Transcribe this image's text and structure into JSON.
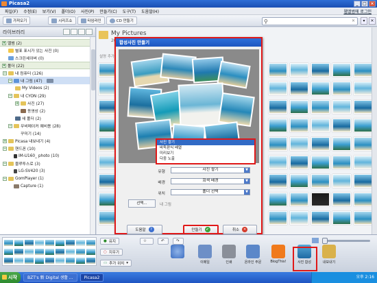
{
  "window": {
    "title": "Picasa2"
  },
  "menu": [
    "파일(F)",
    "수정(E)",
    "보기(V)",
    "폴더(O)",
    "사진(P)",
    "만들기(C)",
    "도구(T)",
    "도움말(H)"
  ],
  "signin": "웹앨범에 로그인",
  "toolbar": [
    "가져오기",
    "시리즈쇼",
    "타임라인",
    "CD 만들기"
  ],
  "library": {
    "title": "라이브러리",
    "tree": [
      {
        "label": "앨범 (2)",
        "group": true
      },
      {
        "label": "별표 표시가 있는 사진 (0)"
      },
      {
        "label": "스크린세이버 (0)"
      },
      {
        "label": "폴더 (22)",
        "group": true
      },
      {
        "label": "내 컴퓨터 (126)"
      },
      {
        "label": "내 그림 (47)"
      },
      {
        "label": "My Videos (2)"
      },
      {
        "label": "내 CYON (29)"
      },
      {
        "label": "사진 (27)"
      },
      {
        "label": "동영상 (2)"
      },
      {
        "label": "새 폴더 (2)"
      },
      {
        "label": "무비메이커 예비용 (28)"
      },
      {
        "label": "꾸미기 (14)"
      },
      {
        "label": "Picasa 내보내기 (4)"
      },
      {
        "label": "핸드폰 (10)"
      },
      {
        "label": "IM-U160_ photo (10)"
      },
      {
        "label": "블루투스로 (3)"
      },
      {
        "label": "LG-SV420 (3)"
      },
      {
        "label": "GomPlayer (1)"
      },
      {
        "label": "Capture (1)"
      }
    ]
  },
  "folder": {
    "name": "My Pictures",
    "date": "20",
    "subtitle": "설명 추가"
  },
  "dialog": {
    "title": "합성사진 만들기",
    "dropdown_options": [
      "사진 쌓기",
      "바둑판식 배열",
      "미리보기",
      "다중 노출"
    ],
    "fields": [
      {
        "label": "유형",
        "value": "사진 쌓기"
      },
      {
        "label": "배경",
        "value": "회색 배경"
      },
      {
        "label": "위치",
        "value": "폴더 선택"
      }
    ],
    "pick_button": "선택...",
    "pick_label": "내 그림",
    "help": "도움말",
    "create": "만들기",
    "cancel": "취소"
  },
  "bottom": {
    "hold": "유지",
    "clear": "지우기",
    "add_to": "추가 위치",
    "actions": [
      "이메일",
      "인쇄",
      "온라인 주문",
      "BlogThis!",
      "사진 합성",
      "내보내기"
    ]
  },
  "taskbar": {
    "start": "시작",
    "tasks": [
      "BZT's 新 Digital 생활 ...",
      "Picasa2"
    ],
    "clock": "오후 2:16"
  },
  "colors": {
    "highlight_red": "#e01818",
    "title_blue": "#1e56c0"
  }
}
